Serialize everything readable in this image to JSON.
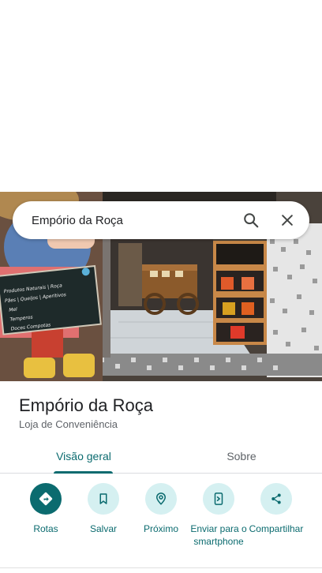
{
  "search": {
    "query": "Empório da Roça",
    "search_icon": "search-icon",
    "close_icon": "close-icon"
  },
  "hero": {
    "chalkboard_lines": [
      "Produtos Naturais | Roça",
      "Pães | Queijos | Aperitivos",
      "Mel",
      "Temperos",
      "Doces Compotas"
    ]
  },
  "place": {
    "name": "Empório da Roça",
    "category": "Loja de Conveniência"
  },
  "tabs": [
    {
      "label": "Visão geral",
      "active": true
    },
    {
      "label": "Sobre",
      "active": false
    }
  ],
  "actions": [
    {
      "label": "Rotas",
      "icon": "directions-icon"
    },
    {
      "label": "Salvar",
      "icon": "bookmark-icon"
    },
    {
      "label": "Próximo",
      "icon": "nearby-icon"
    },
    {
      "label": "Enviar para o smartphone",
      "icon": "send-to-phone-icon"
    },
    {
      "label": "Compartilhar",
      "icon": "share-icon"
    }
  ],
  "colors": {
    "accent": "#0b6b6f",
    "action_bg": "#d5f0f1",
    "text_primary": "#202124",
    "text_secondary": "#5f6368"
  }
}
